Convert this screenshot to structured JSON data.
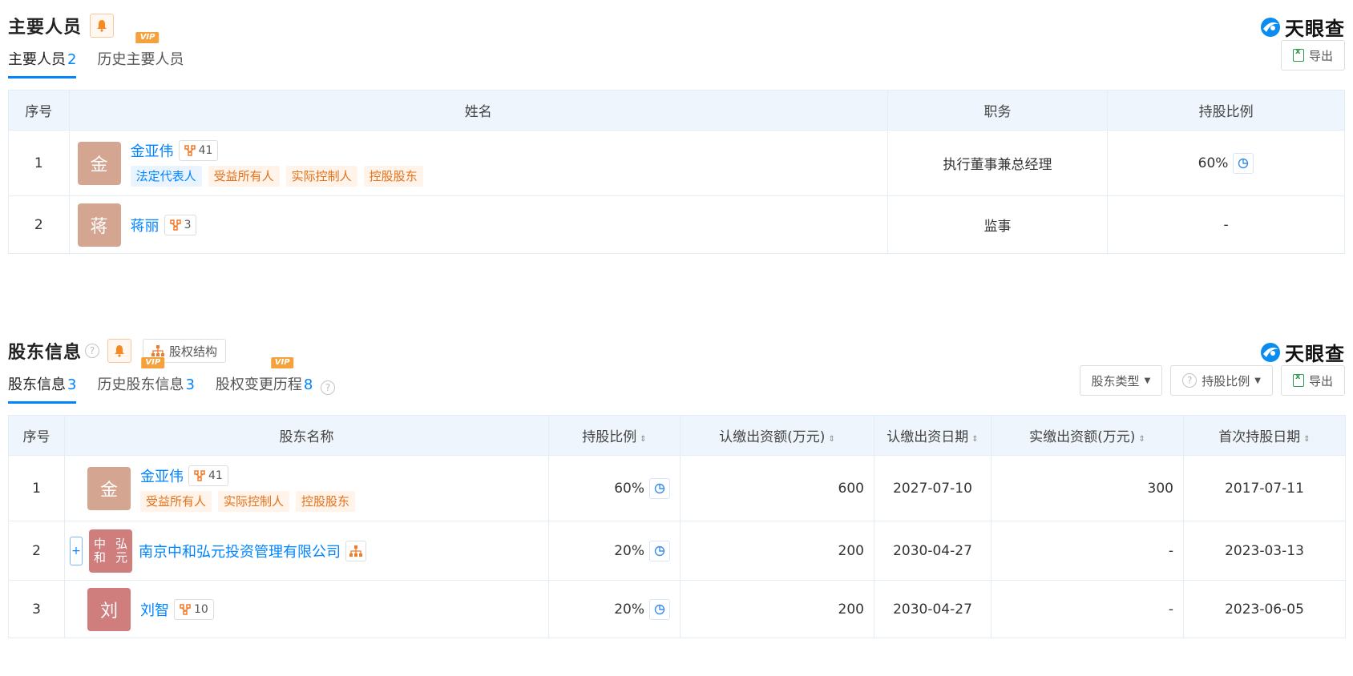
{
  "brand": {
    "name": "天眼查"
  },
  "personnel": {
    "title": "主要人员",
    "tabs": [
      {
        "label": "主要人员",
        "count": "2"
      },
      {
        "label": "历史主要人员",
        "vip": "VIP"
      }
    ],
    "export_label": "导出",
    "columns": [
      "序号",
      "姓名",
      "职务",
      "持股比例"
    ],
    "rows": [
      {
        "index": "1",
        "avatar": "金",
        "name": "金亚伟",
        "related": "41",
        "tags": [
          "法定代表人",
          "受益所有人",
          "实际控制人",
          "控股股东"
        ],
        "position": "执行董事兼总经理",
        "ratio": "60%"
      },
      {
        "index": "2",
        "avatar": "蒋",
        "name": "蒋丽",
        "related": "3",
        "position": "监事",
        "ratio": "-"
      }
    ]
  },
  "shareholders": {
    "title": "股东信息",
    "structure_label": "股权结构",
    "tabs": [
      {
        "label": "股东信息",
        "count": "3"
      },
      {
        "label": "历史股东信息",
        "count": "3",
        "vip": "VIP"
      },
      {
        "label": "股权变更历程",
        "count": "8",
        "vip": "VIP"
      }
    ],
    "filters": {
      "type_label": "股东类型",
      "ratio_label": "持股比例",
      "export_label": "导出"
    },
    "columns": [
      "序号",
      "股东名称",
      "持股比例",
      "认缴出资额(万元)",
      "认缴出资日期",
      "实缴出资额(万元)",
      "首次持股日期"
    ],
    "rows": [
      {
        "index": "1",
        "avatar": "金",
        "name": "金亚伟",
        "related": "41",
        "tags": [
          "受益所有人",
          "实际控制人",
          "控股股东"
        ],
        "ratio": "60%",
        "subscribed": "600",
        "subscribed_date": "2027-07-10",
        "paid": "300",
        "first_date": "2017-07-11"
      },
      {
        "index": "2",
        "avatar_line1": "中和",
        "avatar_line2": "弘元",
        "expand": "+",
        "name": "南京中和弘元投资管理有限公司",
        "ratio": "20%",
        "subscribed": "200",
        "subscribed_date": "2030-04-27",
        "paid": "-",
        "first_date": "2023-03-13"
      },
      {
        "index": "3",
        "avatar": "刘",
        "name": "刘智",
        "related": "10",
        "ratio": "20%",
        "subscribed": "200",
        "subscribed_date": "2030-04-27",
        "paid": "-",
        "first_date": "2023-06-05"
      }
    ]
  },
  "colors": {
    "accent": "#0084ff",
    "header_bg": "#eef5fc",
    "vip": "#f6a23c",
    "tag_orange": "#e3721a",
    "avatar_tan": "#d4a590",
    "avatar_red": "#cf7d7d"
  },
  "icons": [
    "bell-icon",
    "help-icon",
    "equity-structure-icon",
    "excel-icon",
    "related-people-icon",
    "pie-chart-icon",
    "company-structure-icon",
    "tianyancha-logo-icon"
  ]
}
